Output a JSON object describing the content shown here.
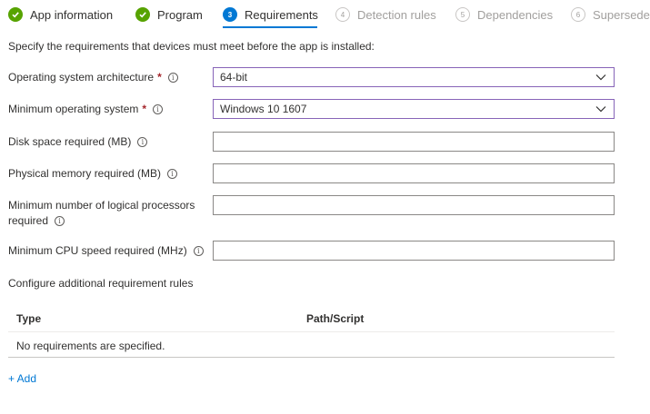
{
  "wizard": {
    "steps": [
      {
        "label": "App information",
        "state": "done",
        "num": ""
      },
      {
        "label": "Program",
        "state": "done",
        "num": ""
      },
      {
        "label": "Requirements",
        "state": "active",
        "num": "3"
      },
      {
        "label": "Detection rules",
        "state": "pending",
        "num": "4"
      },
      {
        "label": "Dependencies",
        "state": "pending",
        "num": "5"
      },
      {
        "label": "Supersedence",
        "state": "pending",
        "num": "6"
      }
    ]
  },
  "intro": "Specify the requirements that devices must meet before the app is installed:",
  "fields": {
    "os_arch": {
      "label": "Operating system architecture",
      "value": "64-bit"
    },
    "min_os": {
      "label": "Minimum operating system",
      "value": "Windows 10 1607"
    },
    "disk": {
      "label": "Disk space required (MB)",
      "value": ""
    },
    "memory": {
      "label": "Physical memory required (MB)",
      "value": ""
    },
    "processors": {
      "label_line1": "Minimum number of logical processors",
      "label_line2": "required",
      "value": ""
    },
    "cpu": {
      "label": "Minimum CPU speed required (MHz)",
      "value": ""
    }
  },
  "required_marker": "*",
  "info_glyph": "i",
  "additional": {
    "heading": "Configure additional requirement rules",
    "columns": [
      "Type",
      "Path/Script"
    ],
    "empty_text": "No requirements are specified.",
    "add_label": "+ Add"
  },
  "colors": {
    "accent": "#0078d4",
    "done": "#57a300",
    "focus_border": "#8764b8",
    "required": "#a4262c"
  }
}
